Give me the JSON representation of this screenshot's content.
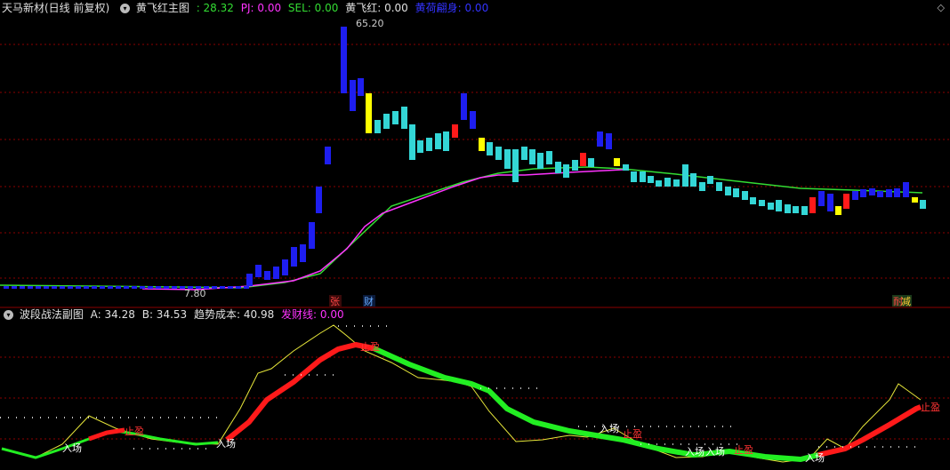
{
  "main_header": {
    "stock": "天马新材(日线 前复权)",
    "indicator": "黄飞红主图",
    "pj_val": ": 28.32",
    "pj_label": "PJ: 0.00",
    "sel_label": "SEL: 0.00",
    "hfh_label": "黄飞红: 0.00",
    "blue_label": "黄荷翩身: 0.00"
  },
  "sub_header": {
    "indicator": "波段战法副图",
    "a_label": "A: 34.28",
    "b_label": "B: 34.53",
    "cost_label": "趋势成本: 40.98",
    "fc_label": "发财线: 0.00"
  },
  "price_labels": {
    "high": "65.20",
    "low": "7.80"
  },
  "markers": {
    "zhang": "张",
    "cai": "财",
    "jian": "减",
    "pei": "耐"
  },
  "sub_labels": [
    "入场",
    "止盈",
    "入场",
    "止盈",
    "入场",
    "止盈",
    "入场",
    "入场",
    "止盈",
    "入场",
    "止盈"
  ],
  "colors": {
    "cyan": "#34d6d6",
    "blue": "#1e1ef0",
    "yellow": "#ffff00",
    "magenta": "#ff33ff",
    "green": "#33dd33",
    "red": "#ff1a1a",
    "grid": "#8b0000"
  },
  "icons": {
    "settings": "down-chevron-circle",
    "diamond": "diamond-icon"
  }
}
